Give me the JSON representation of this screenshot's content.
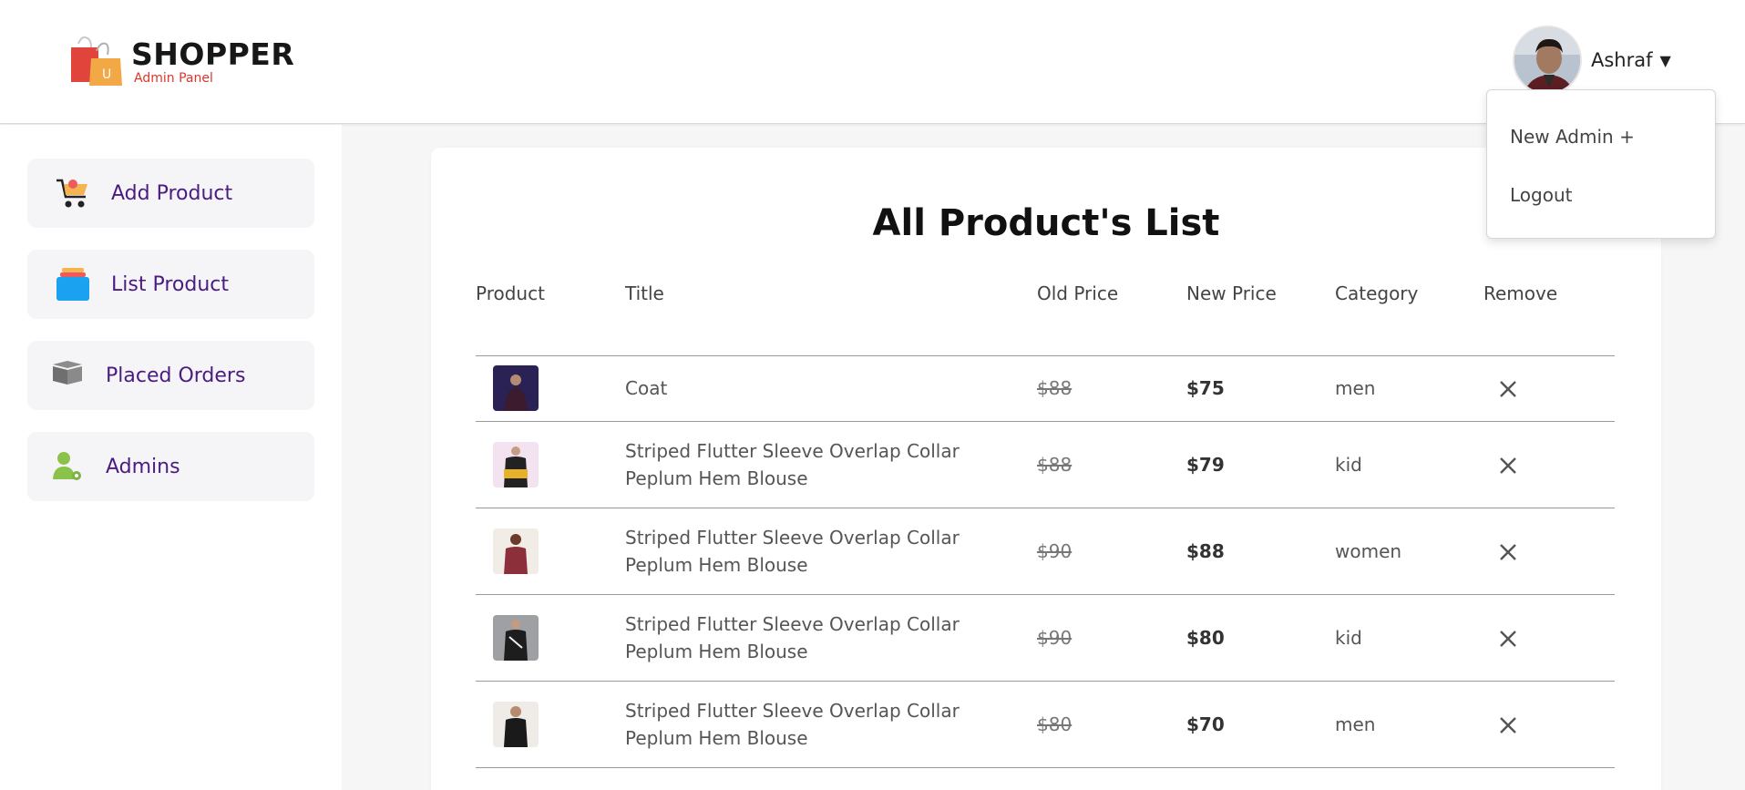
{
  "header": {
    "brand": "SHOPPER",
    "subtitle": "Admin Panel",
    "user_name": "Ashraf",
    "caret": "▼"
  },
  "dropdown": {
    "items": [
      "New Admin +",
      "Logout"
    ]
  },
  "sidebar": {
    "items": [
      {
        "label": "Add Product",
        "icon": "cart-icon"
      },
      {
        "label": "List Product",
        "icon": "stack-icon"
      },
      {
        "label": "Placed Orders",
        "icon": "box-icon"
      },
      {
        "label": "Admins",
        "icon": "admin-user-icon"
      }
    ]
  },
  "main": {
    "title": "All Product's List",
    "columns": [
      "Product",
      "Title",
      "Old Price",
      "New Price",
      "Category",
      "Remove"
    ],
    "rows": [
      {
        "title": "Coat",
        "old_price": "$88",
        "new_price": "$75",
        "category": "men",
        "thumb_color": "#2a2255"
      },
      {
        "title": "Striped Flutter Sleeve Overlap Collar Peplum Hem Blouse",
        "old_price": "$88",
        "new_price": "$79",
        "category": "kid",
        "thumb_color": "#f3e3f0"
      },
      {
        "title": "Striped Flutter Sleeve Overlap Collar Peplum Hem Blouse",
        "old_price": "$90",
        "new_price": "$88",
        "category": "women",
        "thumb_color": "#f1ece6"
      },
      {
        "title": "Striped Flutter Sleeve Overlap Collar Peplum Hem Blouse",
        "old_price": "$90",
        "new_price": "$80",
        "category": "kid",
        "thumb_color": "#9ea0a3"
      },
      {
        "title": "Striped Flutter Sleeve Overlap Collar Peplum Hem Blouse",
        "old_price": "$80",
        "new_price": "$70",
        "category": "men",
        "thumb_color": "#efebe6"
      }
    ]
  },
  "colors": {
    "accent_purple": "#4a1c82",
    "brand_red": "#e0352b"
  }
}
